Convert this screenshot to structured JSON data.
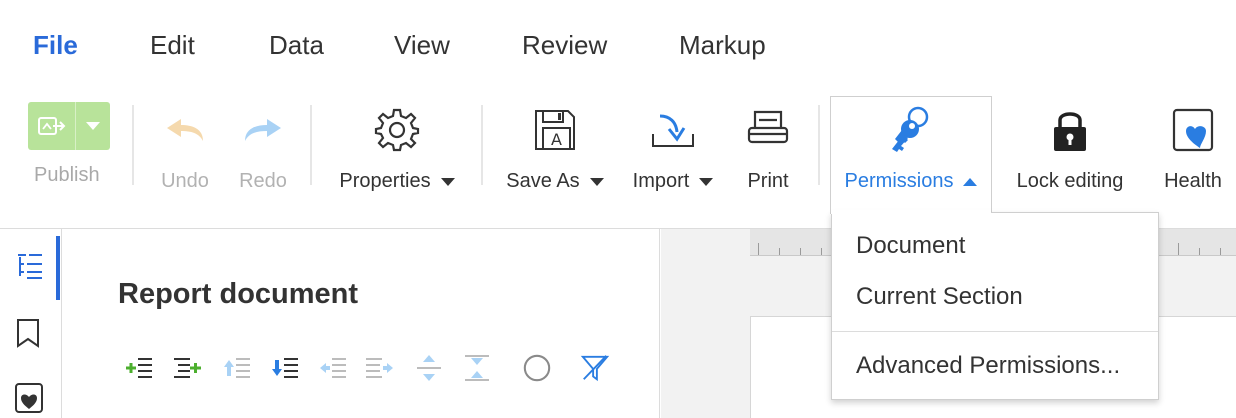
{
  "menu": {
    "file": "File",
    "edit": "Edit",
    "data": "Data",
    "view": "View",
    "review": "Review",
    "markup": "Markup"
  },
  "toolbar": {
    "publish": "Publish",
    "undo": "Undo",
    "redo": "Redo",
    "properties": "Properties",
    "save_as": "Save As",
    "import": "Import",
    "print": "Print",
    "permissions": "Permissions",
    "lock_editing": "Lock editing",
    "health": "Health"
  },
  "permissions_menu": {
    "items": [
      "Document",
      "Current Section"
    ],
    "advanced": "Advanced Permissions..."
  },
  "panel": {
    "title": "Report document"
  },
  "colors": {
    "accent": "#2a6ad9",
    "permissions_blue": "#2a7de1",
    "publish_green": "#b8e39a"
  }
}
